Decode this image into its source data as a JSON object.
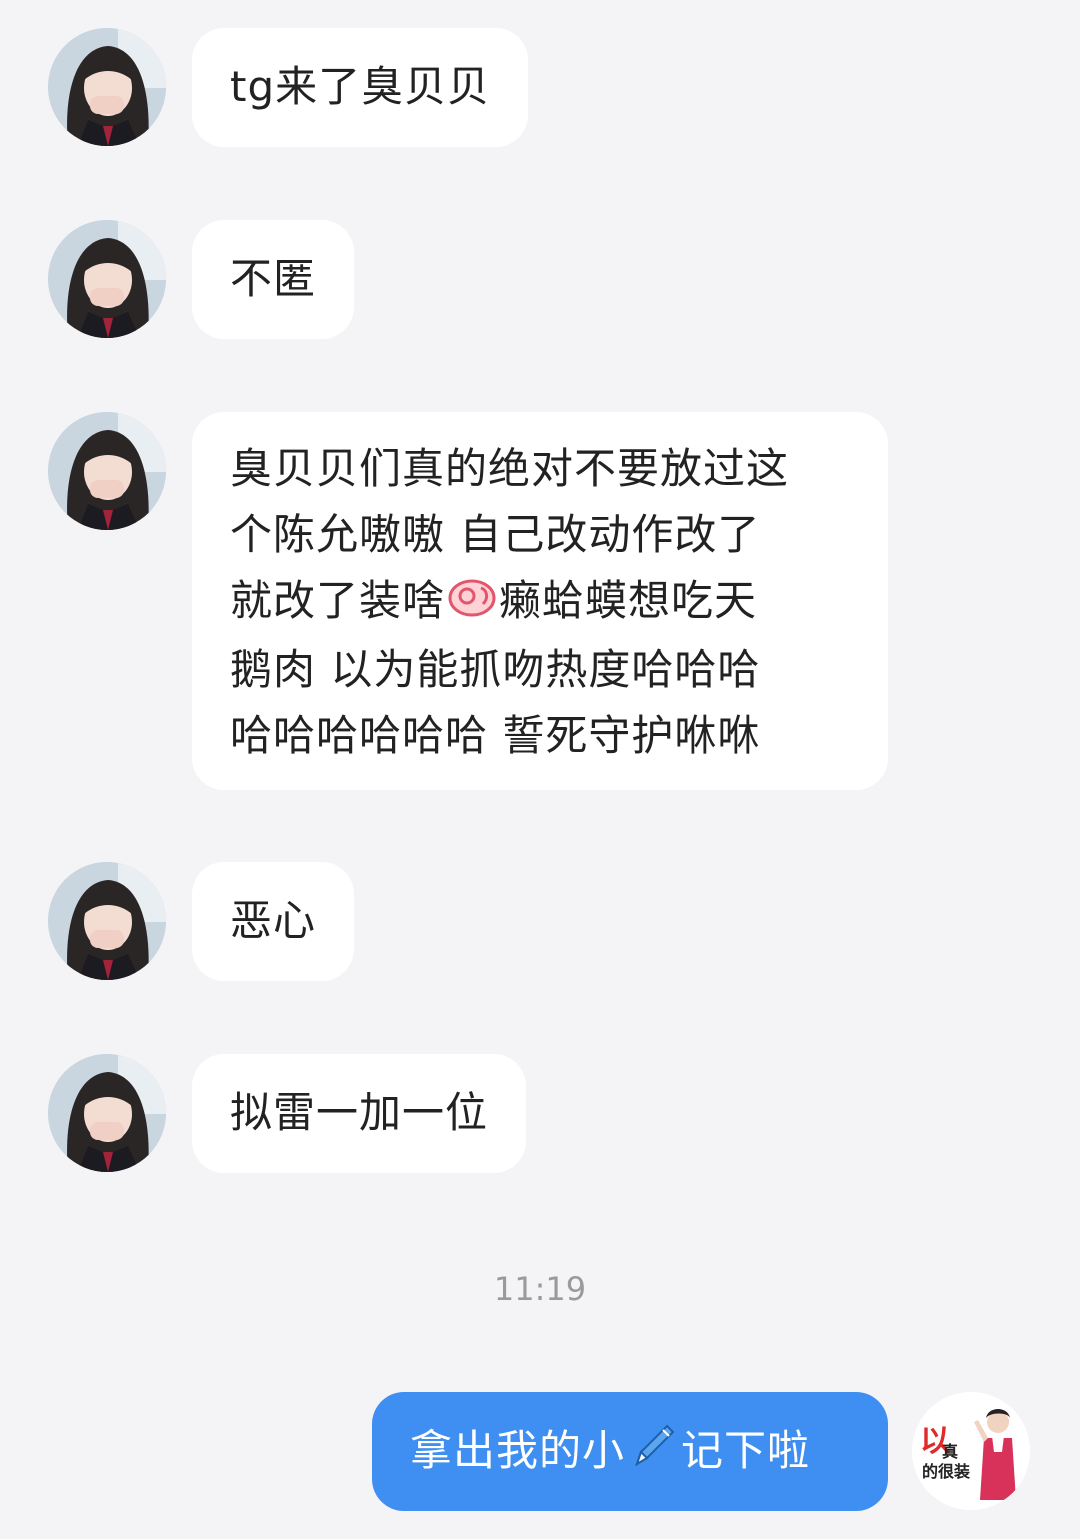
{
  "messages": [
    {
      "text": "tg来了臭贝贝"
    },
    {
      "text": "不匿"
    },
    {
      "lines": [
        "臭贝贝们真的绝对不要放过这",
        "个陈允嗷嗷 自己改动作改了",
        "就改了装啥",
        "癞蛤蟆想吃天",
        "鹅肉 以为能抓吻热度哈哈哈",
        "哈哈哈哈哈哈 誓死守护咻咻"
      ]
    },
    {
      "text": "恶心"
    },
    {
      "text": "拟雷一加一位"
    }
  ],
  "timestamp": "11:19",
  "outgoing": {
    "text_before": "拿出我的小",
    "text_after": "记下啦",
    "icon": "pen-icon"
  },
  "self_avatar": {
    "char_big": "以",
    "char_small": "真",
    "tail": "的很装"
  },
  "colors": {
    "background": "#f4f4f6",
    "bubble_in": "#ffffff",
    "bubble_out": "#3f8ff2",
    "sticker_red": "#e02a2a"
  }
}
